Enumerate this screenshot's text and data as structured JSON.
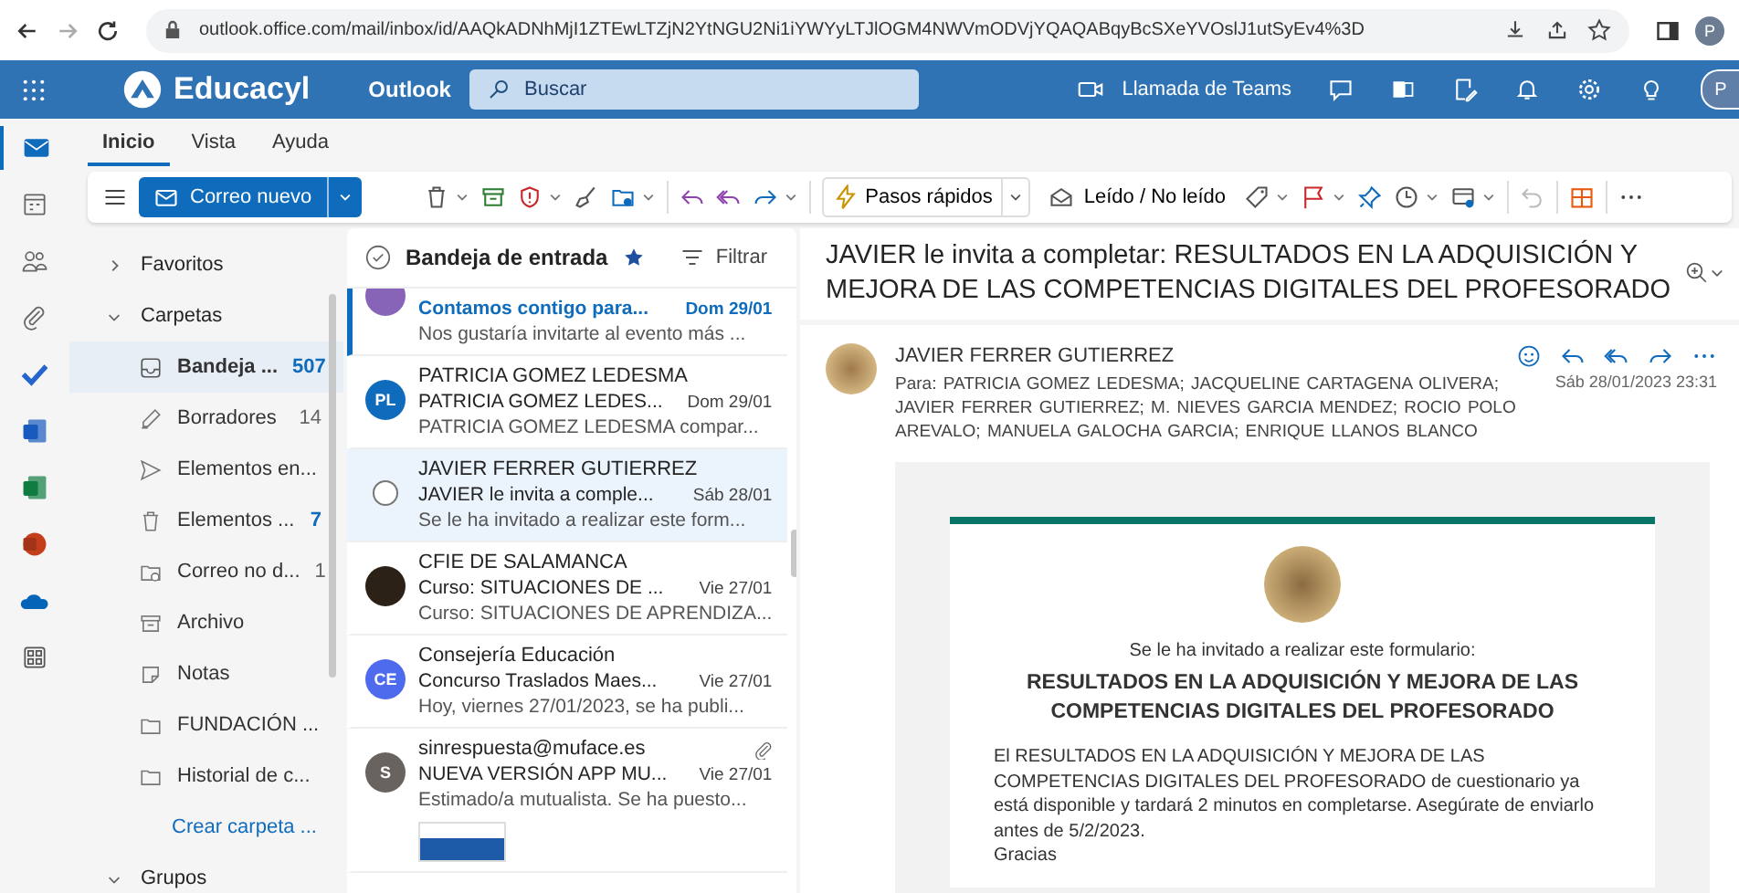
{
  "browser": {
    "url": "outlook.office.com/mail/inbox/id/AAQkADNhMjI1ZTEwLTZjN2YtNGU2Ni1iYWYyLTJlOGM4NWVmODVjYQAQABqyBcSXeYVOslJ1utSyEv4%3D",
    "profile": "P"
  },
  "header": {
    "brand": "Educacyl",
    "app": "Outlook",
    "search_placeholder": "Buscar",
    "teams": "Llamada de Teams",
    "profile": "P"
  },
  "rail": [
    {
      "kind": "mail",
      "selected": true
    },
    {
      "kind": "calendar",
      "selected": false
    },
    {
      "kind": "people",
      "selected": false
    },
    {
      "kind": "files",
      "selected": false
    },
    {
      "kind": "todo",
      "selected": false
    },
    {
      "kind": "word",
      "selected": false
    },
    {
      "kind": "excel",
      "selected": false
    },
    {
      "kind": "powerpoint",
      "selected": false
    },
    {
      "kind": "onedrive",
      "selected": false
    },
    {
      "kind": "apps",
      "selected": false
    }
  ],
  "ribbon_tabs": [
    {
      "label": "Inicio",
      "selected": true
    },
    {
      "label": "Vista",
      "selected": false
    },
    {
      "label": "Ayuda",
      "selected": false
    }
  ],
  "toolbar": {
    "new_mail": "Correo nuevo",
    "quick_steps": "Pasos rápidos",
    "read_unread": "Leído / No leído"
  },
  "folders": {
    "sections": [
      {
        "label": "Favoritos",
        "expanded": false
      },
      {
        "label": "Carpetas",
        "expanded": true
      }
    ],
    "items": [
      {
        "kind": "inbox",
        "name": "Bandeja ...",
        "count": "507",
        "unread": true,
        "selected": true
      },
      {
        "kind": "drafts",
        "name": "Borradores",
        "count": "14",
        "unread": false,
        "selected": false
      },
      {
        "kind": "sent",
        "name": "Elementos en...",
        "selected": false
      },
      {
        "kind": "deleted",
        "name": "Elementos ...",
        "count": "7",
        "unread": true,
        "selected": false
      },
      {
        "kind": "junk",
        "name": "Correo no d...",
        "count": "1",
        "unread": false,
        "selected": false
      },
      {
        "kind": "archive",
        "name": "Archivo",
        "selected": false
      },
      {
        "kind": "notes",
        "name": "Notas",
        "selected": false
      },
      {
        "kind": "folder",
        "name": "FUNDACIÓN ...",
        "selected": false
      },
      {
        "kind": "folder",
        "name": "Historial de c...",
        "selected": false
      }
    ],
    "create": "Crear carpeta ...",
    "groups": {
      "label": "Grupos",
      "expanded": true
    }
  },
  "message_list": {
    "title": "Bandeja de entrada",
    "favorite": true,
    "filter": "Filtrar",
    "messages": [
      {
        "kind": "initials",
        "color": "#8764b8",
        "subject": "Contamos contigo para...",
        "date": "Dom 29/01",
        "preview": "Nos gustaría invitarte al evento más ...",
        "unread": true,
        "selected": false
      },
      {
        "kind": "initials",
        "initials": "PL",
        "color": "#0f6cbd",
        "sender": "PATRICIA GOMEZ LEDESMA",
        "subject": "PATRICIA GOMEZ LEDES...",
        "date": "Dom 29/01",
        "preview": "PATRICIA GOMEZ LEDESMA compar...",
        "unread": false,
        "selected": false
      },
      {
        "sender": "JAVIER FERRER GUTIERREZ",
        "subject": "JAVIER le invita a comple...",
        "date": "Sáb 28/01",
        "preview": "Se le ha invitado a realizar este form...",
        "unread": false,
        "selected": true
      },
      {
        "kind": "photo",
        "color": "#2b2116",
        "sender": "CFIE DE SALAMANCA",
        "subject": "Curso: SITUACIONES DE ...",
        "date": "Vie 27/01",
        "preview": "Curso: SITUACIONES DE APRENDIZA...",
        "unread": false,
        "selected": false
      },
      {
        "kind": "initials",
        "initials": "CE",
        "color": "#4f6bed",
        "sender": "Consejería Educación",
        "subject": "Concurso Traslados Maes...",
        "date": "Vie 27/01",
        "preview": "Hoy, viernes 27/01/2023, se ha publi...",
        "unread": false,
        "selected": false
      },
      {
        "kind": "initials",
        "initials": "S",
        "color": "#69635f",
        "sender": "sinrespuesta@muface.es",
        "subject": "NUEVA VERSIÓN APP MU...",
        "date": "Vie 27/01",
        "preview": "Estimado/a mutualista. Se ha puesto...",
        "unread": false,
        "selected": false,
        "attachment": true,
        "thumbnail": true
      }
    ]
  },
  "reading_pane": {
    "subject": "JAVIER le invita a completar: RESULTADOS EN LA ADQUISICIÓN Y MEJORA DE LAS COMPETENCIAS DIGITALES DEL PROFESORADO",
    "sender": "JAVIER FERRER GUTIERREZ",
    "to_label": "Para:",
    "recipients": [
      "PATRICIA GOMEZ LEDESMA;",
      "JACQUELINE CARTAGENA OLIVERA;",
      "JAVIER FERRER GUTIERREZ;",
      "M. NIEVES GARCIA MENDEZ;",
      "ROCIO POLO AREVALO;",
      "MANUELA GALOCHA GARCIA;",
      "ENRIQUE LLANOS BLANCO"
    ],
    "date": "Sáb 28/01/2023 23:31",
    "body": {
      "intro": "Se le ha invitado a realizar este formulario:",
      "form_title": "RESULTADOS EN LA ADQUISICIÓN Y MEJORA DE LAS COMPETENCIAS DIGITALES DEL PROFESORADO",
      "text": "El RESULTADOS EN LA ADQUISICIÓN Y MEJORA DE LAS COMPETENCIAS DIGITALES DEL PROFESORADO de cuestionario ya está disponible y tardará 2 minutos en completarse. Asegúrate de enviarlo antes de 5/2/2023.",
      "closing": "Gracias"
    }
  }
}
